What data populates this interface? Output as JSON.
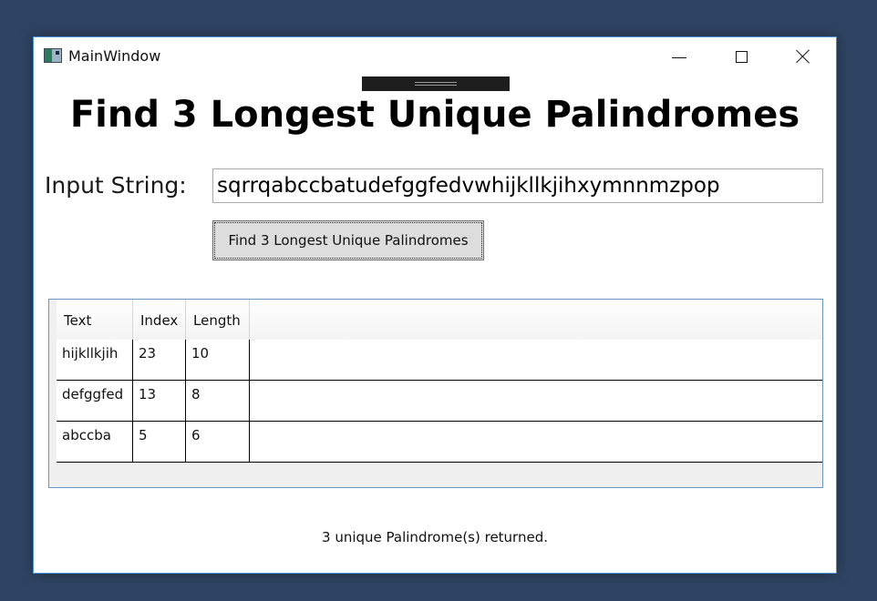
{
  "window": {
    "title": "MainWindow"
  },
  "titlebar_buttons": {
    "minimize_icon": "minimize-icon",
    "maximize_icon": "maximize-icon",
    "close_icon": "close-icon"
  },
  "main": {
    "heading": "Find 3 Longest Unique Palindromes",
    "input_label": "Input String:",
    "input_value": "sqrrqabccbatudefggfedvwhijkllkjihxymnnmzpop",
    "button_label": "Find 3 Longest Unique Palindromes"
  },
  "grid": {
    "columns": [
      "Text",
      "Index",
      "Length"
    ],
    "rows": [
      [
        "hijkllkjih",
        "23",
        "10"
      ],
      [
        "defggfed",
        "13",
        "8"
      ],
      [
        "abccba",
        "5",
        "6"
      ]
    ]
  },
  "status": {
    "message": "3 unique Palindrome(s) returned."
  },
  "colors": {
    "desktop": "#2f4463",
    "window_border": "#4a90d9",
    "grid_border": "#6b95c4",
    "button_bg": "#dddddd"
  }
}
